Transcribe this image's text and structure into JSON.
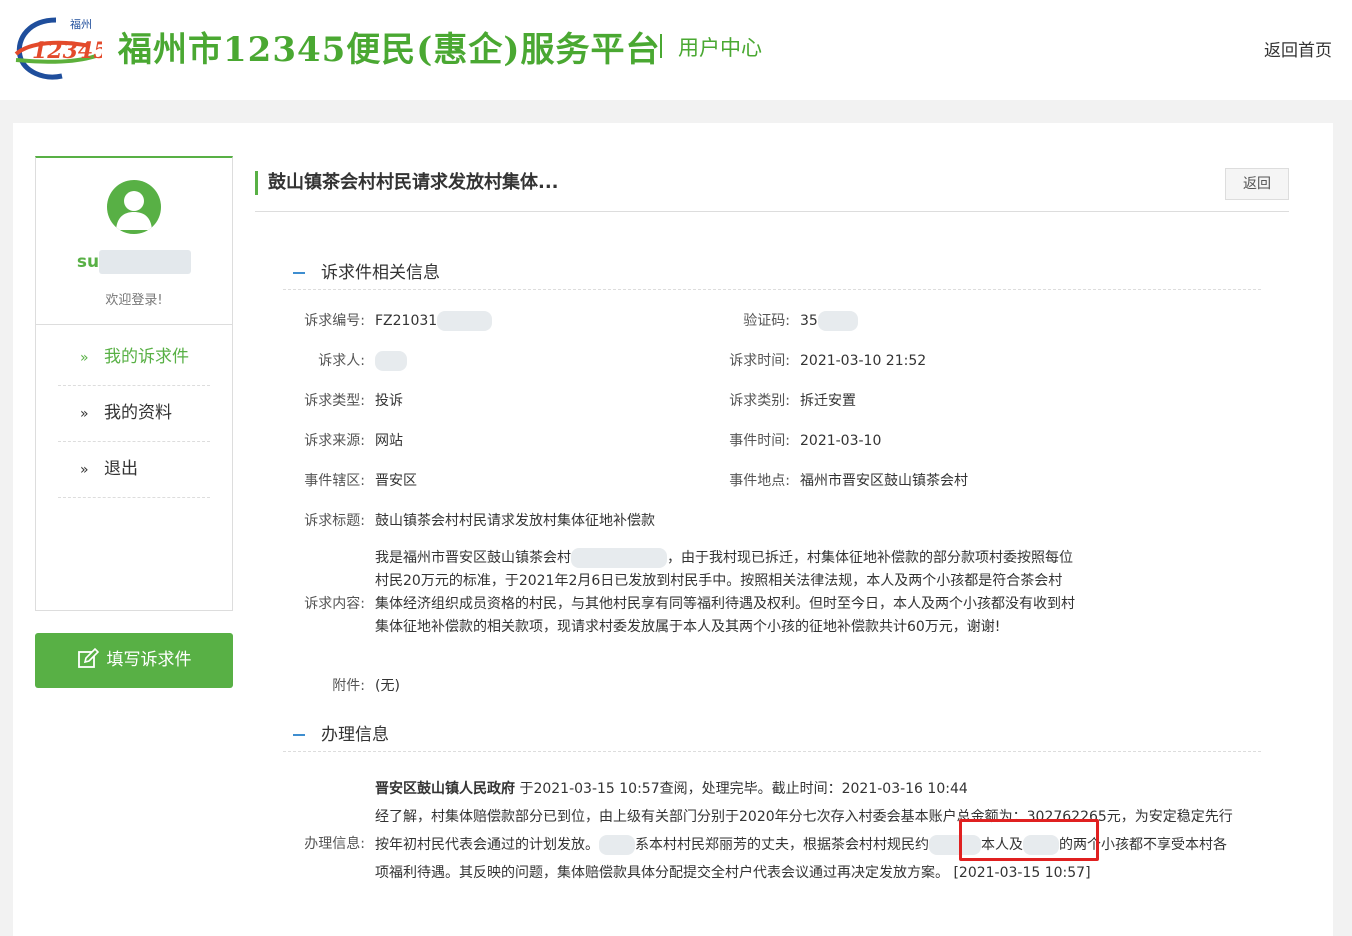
{
  "header": {
    "logo_top": "福州",
    "logo_num": "12345",
    "site_title": "福州市12345便民(惠企)服务平台",
    "user_center": "用户中心",
    "home_link": "返回首页"
  },
  "sidebar": {
    "username_visible": "su",
    "welcome": "欢迎登录!",
    "nav": [
      {
        "label": "我的诉求件",
        "arrow": "»",
        "active": true
      },
      {
        "label": "我的资料",
        "arrow": "»",
        "active": false
      },
      {
        "label": "退出",
        "arrow": "»",
        "active": false
      }
    ],
    "fill_button": "填写诉求件"
  },
  "content": {
    "title": "鼓山镇茶会村村民请求发放村集体...",
    "back_button": "返回",
    "section1": "诉求件相关信息",
    "fields": {
      "code_label": "诉求编号:",
      "code_value": "FZ21031",
      "verify_label": "验证码:",
      "verify_value": "35",
      "person_label": "诉求人:",
      "person_value": "",
      "time_label": "诉求时间:",
      "time_value": "2021-03-10 21:52",
      "type_label": "诉求类型:",
      "type_value": "投诉",
      "category_label": "诉求类别:",
      "category_value": "拆迁安置",
      "source_label": "诉求来源:",
      "source_value": "网站",
      "event_time_label": "事件时间:",
      "event_time_value": "2021-03-10",
      "district_label": "事件辖区:",
      "district_value": "晋安区",
      "location_label": "事件地点:",
      "location_value": "福州市晋安区鼓山镇茶会村",
      "subject_label": "诉求标题:",
      "subject_value": "鼓山镇茶会村村民请求发放村集体征地补偿款",
      "body_label": "诉求内容:",
      "body_p1": "我是福州市晋安区鼓山镇茶会村",
      "body_p2": "，由于我村现已拆迁，村集体征地补偿款的部分款项村委按照每位村民20万元的标准，于2021年2月6日已发放到村民手中。按照相关法律法规，本人及两个小孩都是符合茶会村集体经济组织成员资格的村民，与其他村民享有同等福利待遇及权利。但时至今日，本人及两个小孩都没有收到村集体征地补偿款的相关款项，现请求村委发放属于本人及其两个小孩的征地补偿款共计60万元，谢谢!",
      "attach_label": "附件:",
      "attach_value": "(无)"
    },
    "section2": "办理信息",
    "handling": {
      "label": "办理信息:",
      "org": "晋安区鼓山镇人民政府",
      "status": " 于2021-03-15 10:57查阅，处理完毕。截止时间：2021-03-16 10:44",
      "text_a": "经了解，村集体赔偿款部分已到位，由上级有关部门分别于2020年分七次存入村委会基本账户总金额为：302762265元，为安定稳定先行按年初村民代表会通过的计划发放。",
      "text_b": "系本村村民郑丽芳的丈夫，",
      "text_c": "根据茶会村村规民约",
      "text_d": "本人及",
      "text_e": "的两个小孩都不享受本村各项福利待遇。其反映的问题，集体赔偿款具体分配提交全村户代表会议通过再决定发放方案。 [2021-03-15 10:57]"
    }
  },
  "colors": {
    "brand_green": "#58b045",
    "highlight_red": "#e02020",
    "section_blue": "#3e8ed0"
  }
}
